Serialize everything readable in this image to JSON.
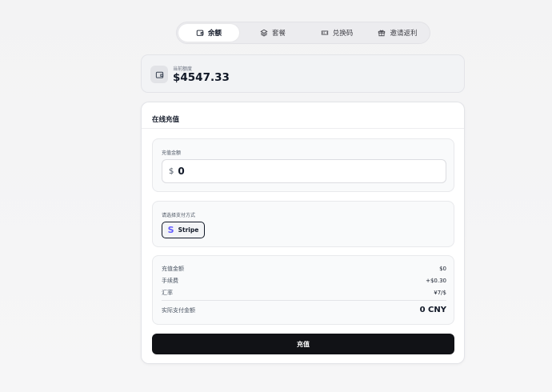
{
  "tabs": [
    {
      "label": "余额",
      "icon": "wallet-icon",
      "active": true
    },
    {
      "label": "套餐",
      "icon": "layers-icon",
      "active": false
    },
    {
      "label": "兑换码",
      "icon": "ticket-icon",
      "active": false
    },
    {
      "label": "邀请返利",
      "icon": "gift-icon",
      "active": false
    }
  ],
  "balance": {
    "label": "当前额度",
    "value": "$4547.33",
    "icon": "wallet-icon"
  },
  "recharge": {
    "title": "在线充值",
    "amount_label": "充值金额",
    "currency_symbol": "$",
    "amount_value": "0",
    "payment_label": "请选择支付方式",
    "payment_methods": [
      {
        "label": "Stripe",
        "icon": "stripe-icon",
        "selected": true
      }
    ],
    "summary": {
      "recharge_amount_label": "充值金额",
      "recharge_amount_value": "$0",
      "fee_label": "手续费",
      "fee_value": "+$0.30",
      "rate_label": "汇率",
      "rate_value": "¥7/$",
      "actual_label": "实际支付金额",
      "actual_value": "0 CNY"
    },
    "submit_label": "充值"
  },
  "colors": {
    "primary_button": "#111216",
    "stripe_brand": "#635bff"
  }
}
